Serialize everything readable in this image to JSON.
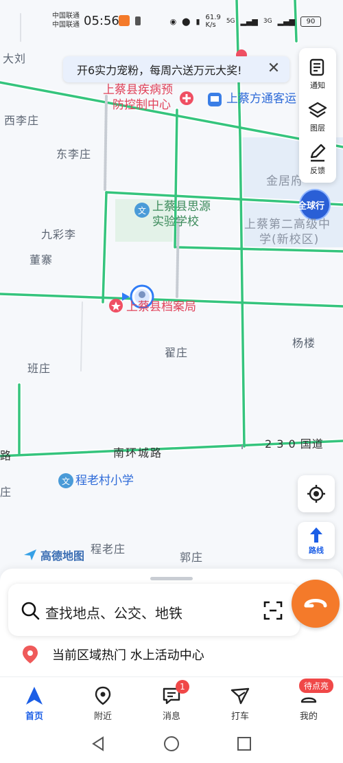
{
  "status_bar": {
    "carrier_1": "中国联通",
    "carrier_2": "中国联通",
    "time": "05:56",
    "net_speed": "61.9",
    "net_speed_unit": "K/s",
    "net_type_1": "5G",
    "net_type_2": "3G",
    "battery": "90"
  },
  "banner": {
    "text": "开6实力宠粉，每周六送万元大奖!"
  },
  "toolbar": {
    "notice": "通知",
    "layers": "图层",
    "feedback": "反馈"
  },
  "map": {
    "places": {
      "dali": "大刘",
      "xilizhuang": "西李庄",
      "donglizhuang": "东李庄",
      "jiucaili": "九彩李",
      "dongzhai": "董寨",
      "banzhuang": "班庄",
      "zhaizhuang": "翟庄",
      "yanglou": "杨楼",
      "chenglaozhuang": "程老庄",
      "guozhuang": "郭庄",
      "jinjufu": "金居府",
      "left_edge_1": "路",
      "left_edge_2": "庄"
    },
    "pois": {
      "cdc_line1": "上蔡县疾病预",
      "cdc_line2": "防控制中心",
      "bus_station": "上蔡方通客运",
      "siyuan_line1": "上蔡县思源",
      "siyuan_line2": "实验学校",
      "archives": "上蔡县档案局",
      "school2_line1": "上蔡第二高级中",
      "school2_line2": "学(新校区)",
      "chenglaocun_school": "程老村小学",
      "quanqiuxing": "全球行"
    },
    "roads": {
      "nanhuan": "南环城路",
      "guodao": "2 3 0 国道"
    }
  },
  "brand": "高德地图",
  "route_button": "路线",
  "search": {
    "placeholder": "查找地点、公交、地铁"
  },
  "hot": {
    "text": "当前区域热门 水上活动中心"
  },
  "tabs": [
    {
      "label": "首页"
    },
    {
      "label": "附近"
    },
    {
      "label": "消息",
      "badge": "1"
    },
    {
      "label": "打车"
    },
    {
      "label": "我的",
      "badge": "待点亮"
    }
  ],
  "colors": {
    "road": "#35c47d",
    "accent": "#1b5ee6",
    "didi_orange": "#f47a2a",
    "badge_red": "#f04848"
  }
}
